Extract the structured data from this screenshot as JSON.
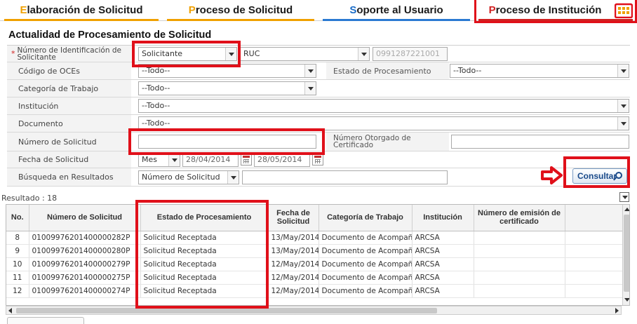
{
  "nav": {
    "tabs": [
      {
        "first": "E",
        "rest": "laboración de Solicitud"
      },
      {
        "first": "P",
        "rest": "roceso de Solicitud"
      },
      {
        "first": "S",
        "rest": "oporte al Usuario"
      },
      {
        "first": "P",
        "rest": "roceso de Institución"
      }
    ],
    "icon": "tablet-grid-icon"
  },
  "page_title": "Actualidad de Procesamiento de Solicitud",
  "form": {
    "id_label": "Número de Identificación de Solicitante",
    "id_type_value": "Solicitante",
    "id_doc_value": "RUC",
    "id_number_value": "0991287221001",
    "oces_label": "Código de OCEs",
    "oces_value": "--Todo--",
    "estado_label": "Estado de Procesamiento",
    "estado_value": "--Todo--",
    "categoria_label": "Categoría de Trabajo",
    "categoria_value": "--Todo--",
    "institucion_label": "Institución",
    "institucion_value": "--Todo--",
    "documento_label": "Documento",
    "documento_value": "--Todo--",
    "numero_label": "Número de Solicitud",
    "numero_value": "",
    "otorgado_label": "Número Otorgado de Certificado",
    "otorgado_value": "",
    "fecha_label": "Fecha de Solicitud",
    "fecha_period": "Mes",
    "fecha_from": "28/04/2014",
    "fecha_to": "28/05/2014",
    "busqueda_label": "Búsqueda en Resultados",
    "busqueda_field": "Número de Solicitud",
    "busqueda_value": ""
  },
  "consultar_label": "Consultar",
  "result_label": "Resultado : 18",
  "table": {
    "headers": [
      "No.",
      "Número de Solicitud",
      "Estado de Procesamiento",
      "Fecha de Solicitud",
      "Categoría de Trabajo",
      "Institución",
      "Número de emisión de certificado"
    ],
    "rows": [
      [
        "8",
        "01009976201400000282P",
        "Solicitud Receptada",
        "13/May/2014",
        "Documento de Acompañamier",
        "ARCSA",
        ""
      ],
      [
        "9",
        "01009976201400000280P",
        "Solicitud Receptada",
        "13/May/2014",
        "Documento de Acompañamier",
        "ARCSA",
        ""
      ],
      [
        "10",
        "01009976201400000279P",
        "Solicitud Receptada",
        "12/May/2014",
        "Documento de Acompañamier",
        "ARCSA",
        ""
      ],
      [
        "11",
        "01009976201400000275P",
        "Solicitud Receptada",
        "12/May/2014",
        "Documento de Acompañamier",
        "ARCSA",
        ""
      ],
      [
        "12",
        "01009976201400000274P",
        "Solicitud Receptada",
        "12/May/2014",
        "Documento de Acompañamier",
        "ARCSA",
        ""
      ]
    ]
  },
  "colors": {
    "accent_orange": "#f0a000",
    "accent_blue": "#2a7ad2",
    "accent_red": "#d02020",
    "highlight": "#e0101a"
  }
}
